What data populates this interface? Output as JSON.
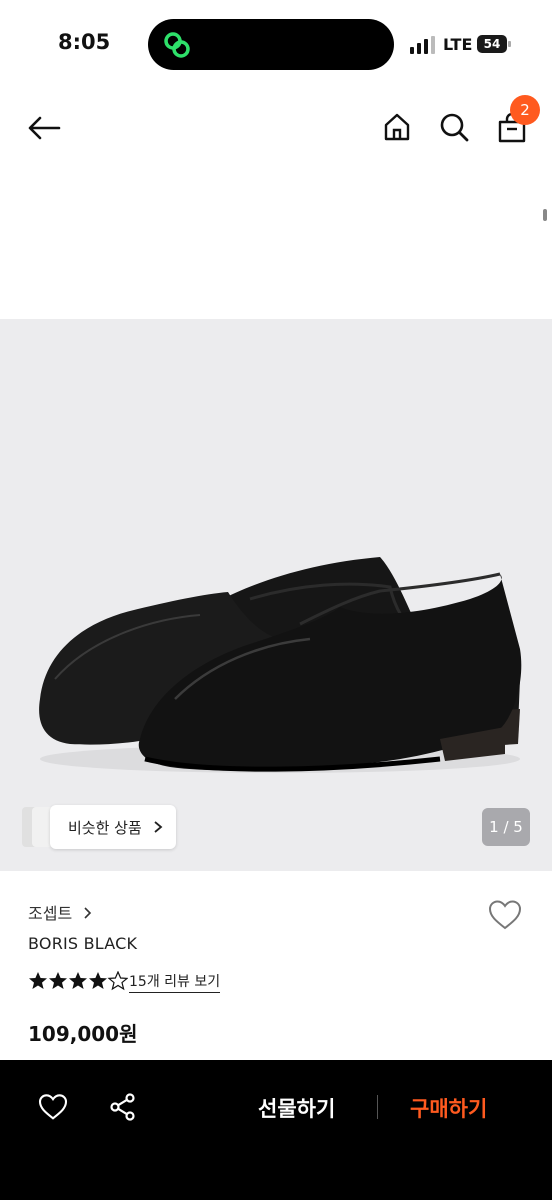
{
  "status_bar": {
    "time": "8:05",
    "network": "LTE",
    "battery": "54"
  },
  "header": {
    "cart_count": "2"
  },
  "gallery": {
    "similar_label": "비슷한 상품",
    "counter": "1 / 5"
  },
  "product": {
    "brand": "조셉트",
    "name": "BORIS BLACK",
    "rating": 4.5,
    "reviews_link": "15개 리뷰 보기",
    "price": "109,000원"
  },
  "bottom_bar": {
    "gift_label": "선물하기",
    "buy_label": "구매하기"
  },
  "colors": {
    "accent": "#ff5a1f",
    "bar_bg": "#000000",
    "image_bg": "#ececee"
  }
}
